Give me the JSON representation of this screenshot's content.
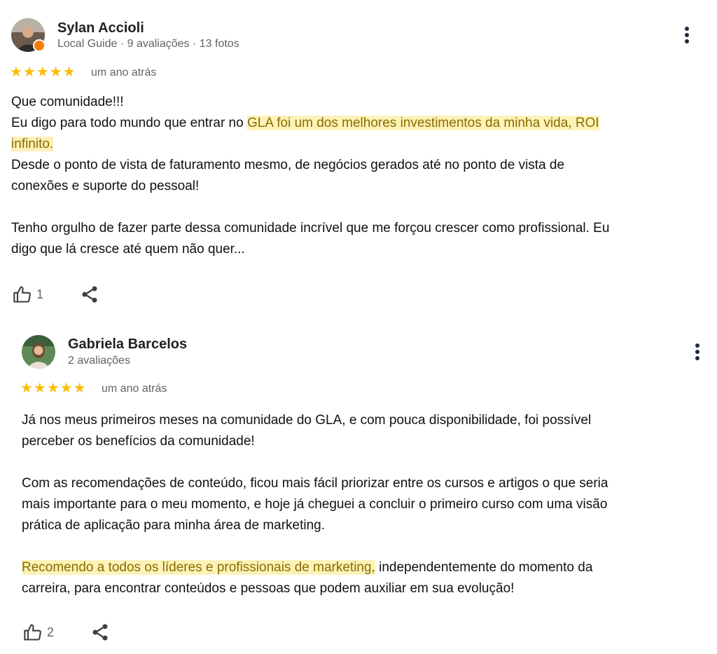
{
  "reviews": [
    {
      "author": "Sylan Accioli",
      "meta": "Local Guide · 9 avaliações · 13 fotos",
      "stars": "★★★★★",
      "time": "um ano atrás",
      "p1_l1": "Que comunidade!!!",
      "p1_l2_a": "Eu digo para todo mundo que entrar no ",
      "p1_l2_hl": "GLA foi um dos melhores investimentos da minha vida, ROI",
      "p1_l3_hl": "infinito.",
      "p1_l4": "Desde o ponto de vista de faturamento mesmo, de negócios gerados até no ponto de vista de",
      "p1_l5": "conexões e suporte do pessoal!",
      "p2_l1": "Tenho orgulho de fazer parte dessa comunidade incrível que me forçou crescer como profissional. Eu",
      "p2_l2": "digo que lá cresce até quem não quer...",
      "likes": "1"
    },
    {
      "author": "Gabriela Barcelos",
      "meta": "2 avaliações",
      "stars": "★★★★★",
      "time": "um ano atrás",
      "p1_l1": "Já nos meus primeiros meses na comunidade do GLA, e com pouca disponibilidade, foi possível",
      "p1_l2": "perceber os benefícios da comunidade!",
      "p2_l1": "Com as recomendações de conteúdo, ficou mais fácil priorizar entre os cursos e artigos o que seria",
      "p2_l2": "mais importante para o meu momento, e hoje já cheguei a concluir o primeiro curso com uma visão",
      "p2_l3": "prática de aplicação para minha área de marketing.",
      "p3_l1_hl": "Recomendo a todos os líderes e profissionais de marketing,",
      "p3_l1_b": " independentemente do momento da",
      "p3_l2": "carreira, para encontrar conteúdos e pessoas que podem auxiliar em sua evolução!",
      "likes": "2"
    }
  ],
  "icons": {
    "like": "thumbs-up-icon",
    "share": "share-icon",
    "more": "more-vert-icon"
  },
  "colors": {
    "star": "#fbbc04",
    "highlight_bg": "#fdf2b8",
    "highlight_text": "#8a6d00",
    "local_guide_badge": "#f57c00"
  }
}
